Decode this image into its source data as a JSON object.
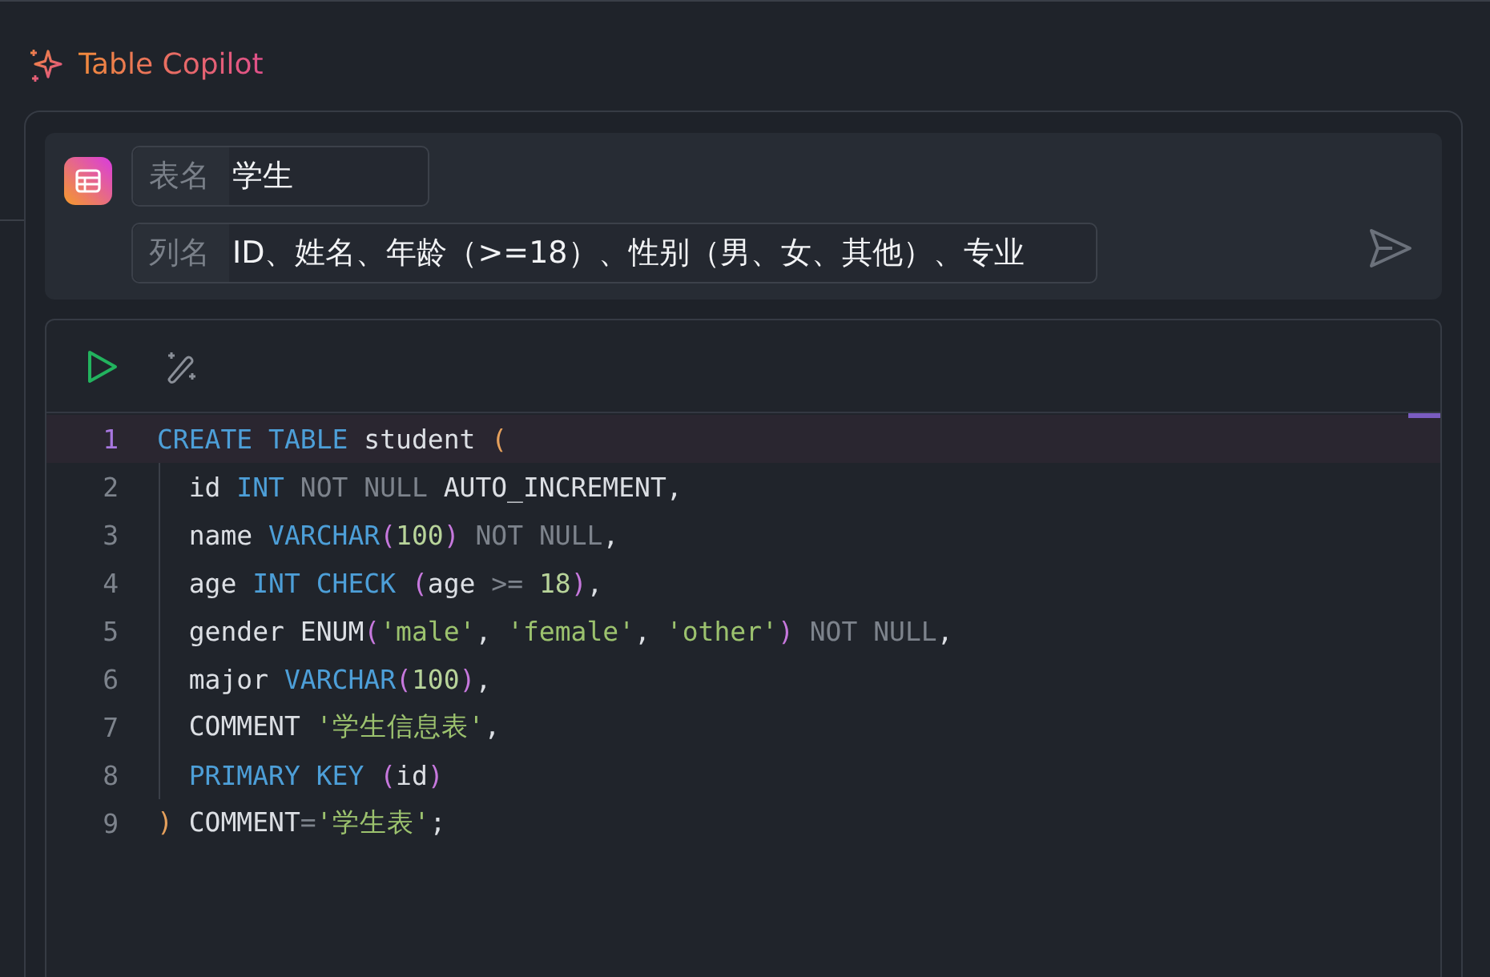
{
  "header": {
    "title": "Table Copilot"
  },
  "form": {
    "fields": [
      {
        "label": "表名",
        "value": "学生"
      },
      {
        "label": "列名",
        "value": "ID、姓名、年龄（>=18）、性别（男、女、其他）、专业"
      }
    ]
  },
  "code": {
    "lines": [
      {
        "number": "1",
        "current": true,
        "tokens": [
          {
            "kind": "keyword",
            "text": "CREATE TABLE"
          },
          {
            "kind": "ident",
            "text": " student "
          },
          {
            "kind": "bracket",
            "text": "("
          }
        ]
      },
      {
        "number": "2",
        "current": false,
        "tokens": [
          {
            "kind": "ident",
            "text": "  id "
          },
          {
            "kind": "keyword",
            "text": "INT"
          },
          {
            "kind": "muted",
            "text": " NOT NULL"
          },
          {
            "kind": "ident",
            "text": " AUTO_INCREMENT,"
          }
        ]
      },
      {
        "number": "3",
        "current": false,
        "tokens": [
          {
            "kind": "ident",
            "text": "  name "
          },
          {
            "kind": "keyword",
            "text": "VARCHAR"
          },
          {
            "kind": "paren",
            "text": "("
          },
          {
            "kind": "number",
            "text": "100"
          },
          {
            "kind": "paren",
            "text": ")"
          },
          {
            "kind": "muted",
            "text": " NOT NULL"
          },
          {
            "kind": "ident",
            "text": ","
          }
        ]
      },
      {
        "number": "4",
        "current": false,
        "tokens": [
          {
            "kind": "ident",
            "text": "  age "
          },
          {
            "kind": "keyword",
            "text": "INT CHECK"
          },
          {
            "kind": "paren",
            "text": " ("
          },
          {
            "kind": "ident",
            "text": "age "
          },
          {
            "kind": "muted",
            "text": ">= "
          },
          {
            "kind": "number",
            "text": "18"
          },
          {
            "kind": "paren",
            "text": ")"
          },
          {
            "kind": "ident",
            "text": ","
          }
        ]
      },
      {
        "number": "5",
        "current": false,
        "tokens": [
          {
            "kind": "ident",
            "text": "  gender ENUM"
          },
          {
            "kind": "paren",
            "text": "("
          },
          {
            "kind": "string",
            "text": "'male'"
          },
          {
            "kind": "ident",
            "text": ", "
          },
          {
            "kind": "string",
            "text": "'female'"
          },
          {
            "kind": "ident",
            "text": ", "
          },
          {
            "kind": "string",
            "text": "'other'"
          },
          {
            "kind": "paren",
            "text": ")"
          },
          {
            "kind": "muted",
            "text": " NOT NULL"
          },
          {
            "kind": "ident",
            "text": ","
          }
        ]
      },
      {
        "number": "6",
        "current": false,
        "tokens": [
          {
            "kind": "ident",
            "text": "  major "
          },
          {
            "kind": "keyword",
            "text": "VARCHAR"
          },
          {
            "kind": "paren",
            "text": "("
          },
          {
            "kind": "number",
            "text": "100"
          },
          {
            "kind": "paren",
            "text": ")"
          },
          {
            "kind": "ident",
            "text": ","
          }
        ]
      },
      {
        "number": "7",
        "current": false,
        "tokens": [
          {
            "kind": "ident",
            "text": "  COMMENT "
          },
          {
            "kind": "string",
            "text": "'学生信息表'"
          },
          {
            "kind": "ident",
            "text": ","
          }
        ]
      },
      {
        "number": "8",
        "current": false,
        "tokens": [
          {
            "kind": "keyword",
            "text": "  PRIMARY KEY"
          },
          {
            "kind": "paren",
            "text": " ("
          },
          {
            "kind": "ident",
            "text": "id"
          },
          {
            "kind": "paren",
            "text": ")"
          }
        ]
      },
      {
        "number": "9",
        "current": false,
        "tokens": [
          {
            "kind": "bracket",
            "text": ")"
          },
          {
            "kind": "ident",
            "text": " COMMENT"
          },
          {
            "kind": "muted",
            "text": "="
          },
          {
            "kind": "string",
            "text": "'学生表'"
          },
          {
            "kind": "ident",
            "text": ";"
          }
        ]
      }
    ]
  }
}
